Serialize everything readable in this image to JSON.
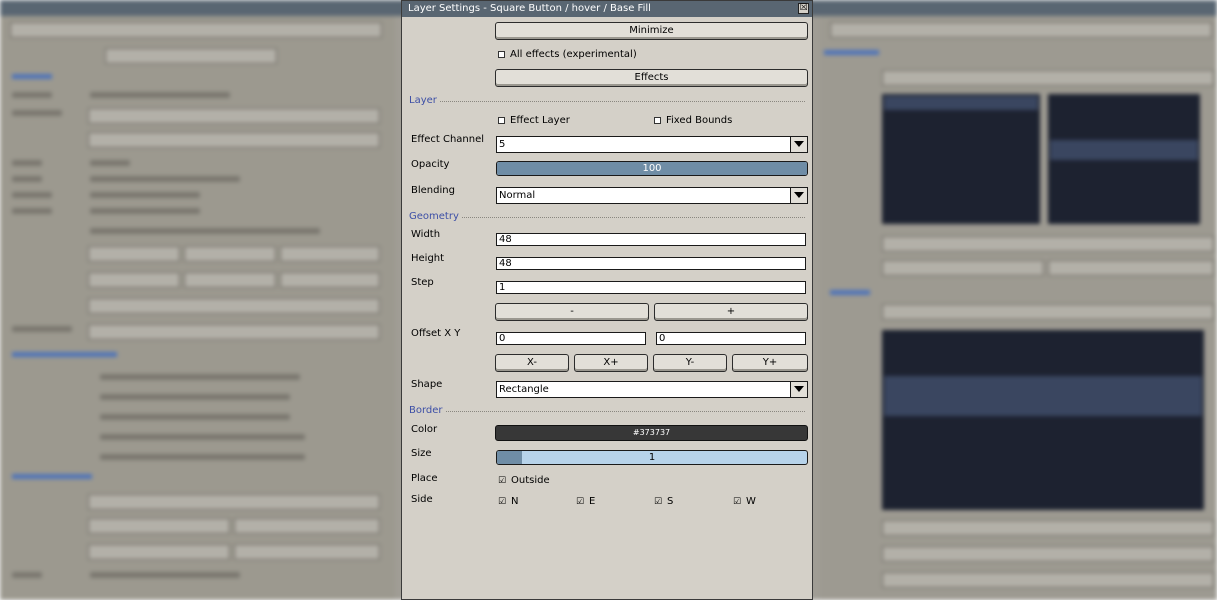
{
  "dialog": {
    "title": "Layer Settings - Square Button / hover / Base Fill",
    "close_glyph": "☒",
    "minimize_label": "Minimize",
    "all_effects_label": "All effects (experimental)",
    "effects_label": "Effects"
  },
  "layer": {
    "section_label": "Layer",
    "effect_layer_label": "Effect Layer",
    "fixed_bounds_label": "Fixed Bounds",
    "effect_channel_label": "Effect Channel",
    "effect_channel_value": "5",
    "opacity_label": "Opacity",
    "opacity_value": "100",
    "opacity_fraction": 1.0,
    "blending_label": "Blending",
    "blending_value": "Normal"
  },
  "geometry": {
    "section_label": "Geometry",
    "width_label": "Width",
    "width_value": "48",
    "height_label": "Height",
    "height_value": "48",
    "step_label": "Step",
    "step_value": "1",
    "minus_label": "-",
    "plus_label": "+",
    "offset_label": "Offset X Y",
    "offset_x_value": "0",
    "offset_y_value": "0",
    "x_minus_label": "X-",
    "x_plus_label": "X+",
    "y_minus_label": "Y-",
    "y_plus_label": "Y+",
    "shape_label": "Shape",
    "shape_value": "Rectangle"
  },
  "border": {
    "section_label": "Border",
    "color_label": "Color",
    "color_value": "#373737",
    "size_label": "Size",
    "size_value": "1",
    "size_fraction": 0.08,
    "place_label": "Place",
    "outside_label": "Outside",
    "side_label": "Side",
    "side_n_label": "N",
    "side_e_label": "E",
    "side_s_label": "S",
    "side_w_label": "W",
    "check_glyph": "☑"
  },
  "colors": {
    "titlebar": "#596672",
    "accent": "#3d4fa6",
    "panel": "#d4d0c8",
    "slider_fill": "#6f8da6",
    "slider_track": "#b7d3ea"
  }
}
